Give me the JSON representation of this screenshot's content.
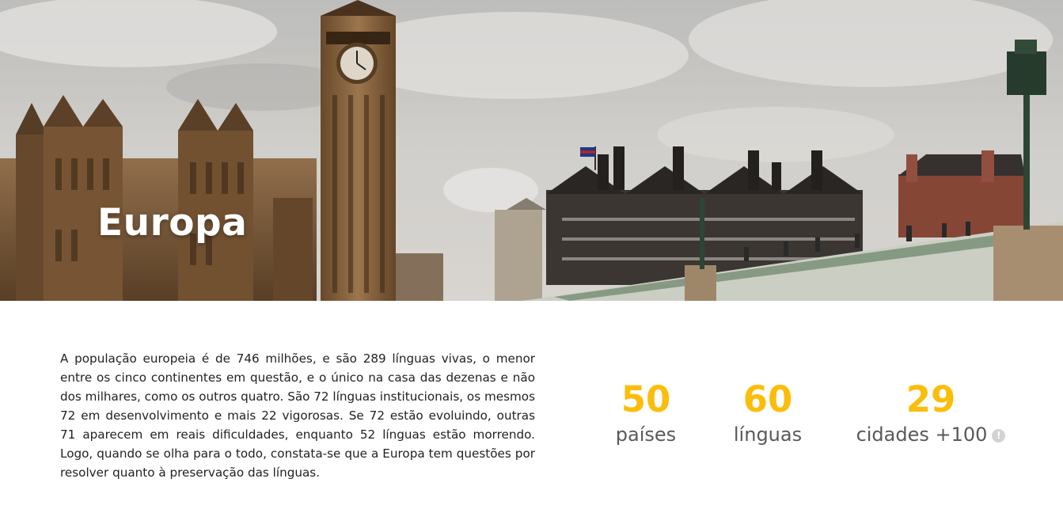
{
  "hero": {
    "title": "Europa"
  },
  "description": "A população europeia é de 746 milhões, e são 289 línguas vivas, o menor entre os cinco continentes em questão, e o único na casa das dezenas e não dos milhares, como os outros quatro. São 72 línguas institucionais, os mesmos 72 em desenvolvimento e mais 22 vigorosas. Se 72 estão evoluindo, outras 71 aparecem em reais dificuldades, enquanto 52 línguas estão morrendo. Logo, quando se olha para o todo, constata-se que a Europa tem questões por resolver quanto à preservação das línguas.",
  "stats": [
    {
      "number": "50",
      "label": "países"
    },
    {
      "number": "60",
      "label": "línguas"
    },
    {
      "number": "29",
      "label": "cidades +100",
      "icon": "info-icon"
    }
  ],
  "colors": {
    "accent": "#FCBD0A",
    "label": "#58595b",
    "text": "#222222"
  }
}
